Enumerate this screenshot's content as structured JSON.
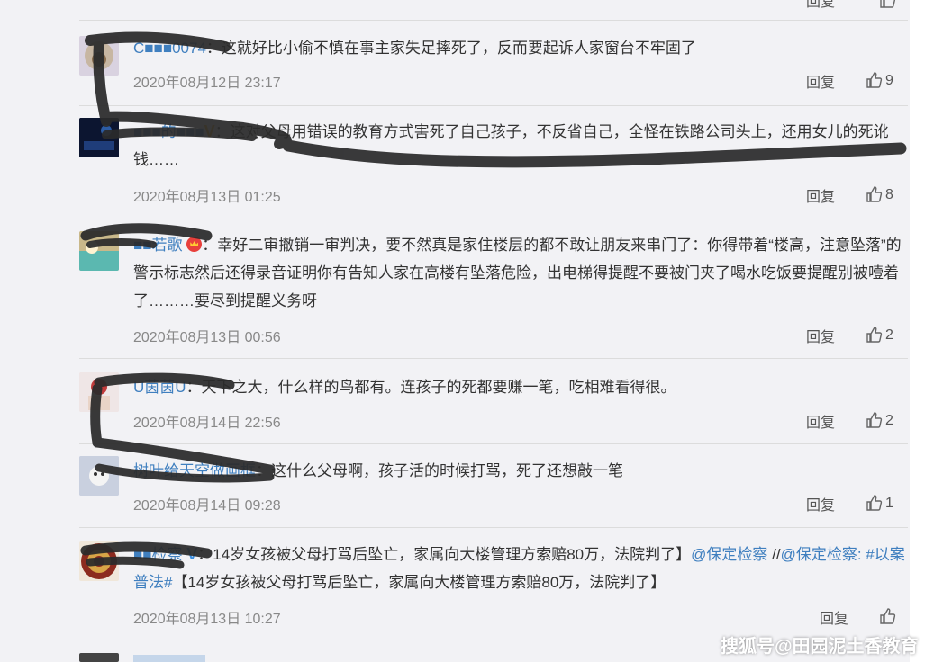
{
  "comments": [
    {
      "user": "C■■■0074",
      "text": "：这就好比小偷不慎在事主家失足摔死了，反而要起诉人家窗台不牢固了",
      "time": "2020年08月12日 23:17",
      "reply": "回复",
      "likes": "9"
    },
    {
      "user": "■■■的■■■",
      "text": "：这对父母用错误的教育方式害死了自己孩子，不反省自己，全怪在铁路公司头上，还用女儿的死讹钱……",
      "time": "2020年08月13日 01:25",
      "reply": "回复",
      "likes": "8"
    },
    {
      "user": "■■若歌",
      "text": "：幸好二审撤销一审判决，要不然真是家住楼层的都不敢让朋友来串门了：你得带着“楼高，注意坠落”的警示标志然后还得录音证明你有告知人家在高楼有坠落危险，出电梯得提醒不要被门夹了喝水吃饭要提醒别被噎着了………要尽到提醒义务呀",
      "time": "2020年08月13日 00:56",
      "reply": "回复",
      "likes": "2"
    },
    {
      "user": "U茵茵U",
      "text": "：天下之大，什么样的鸟都有。连孩子的死都要赚一笔，吃相难看得很。",
      "time": "2020年08月14日 22:56",
      "reply": "回复",
      "likes": "2"
    },
    {
      "user": "树叶给天空做画框",
      "text": "：这什么父母啊，孩子活的时候打骂，死了还想敲一笔",
      "time": "2020年08月14日 09:28",
      "reply": "回复",
      "likes": "1"
    },
    {
      "user": "■■检察",
      "text_a": "：14岁女孩被父母打骂后坠亡，家属向大楼管理方索赔80万，法院判了】",
      "mention1": "@保定检察",
      "sep": " //",
      "mention2": "@保定检察",
      "colon": ": ",
      "hashtag": "#以案普法#",
      "text_b": "【14岁女孩被父母打骂后坠亡，家属向大楼管理方索赔80万，法院判了】",
      "time": "2020年08月13日 10:27",
      "reply": "回复",
      "likes": ""
    }
  ],
  "top_partial": {
    "reply": "回复"
  },
  "watermark": "搜狐号@田园泥土香教育",
  "colors": {
    "link": "#3f7fbf",
    "verified_yellow": "#f0a818",
    "verified_blue": "#3c8fe0",
    "background": "#f2f2f5",
    "scribble": "#2b2b2b"
  }
}
